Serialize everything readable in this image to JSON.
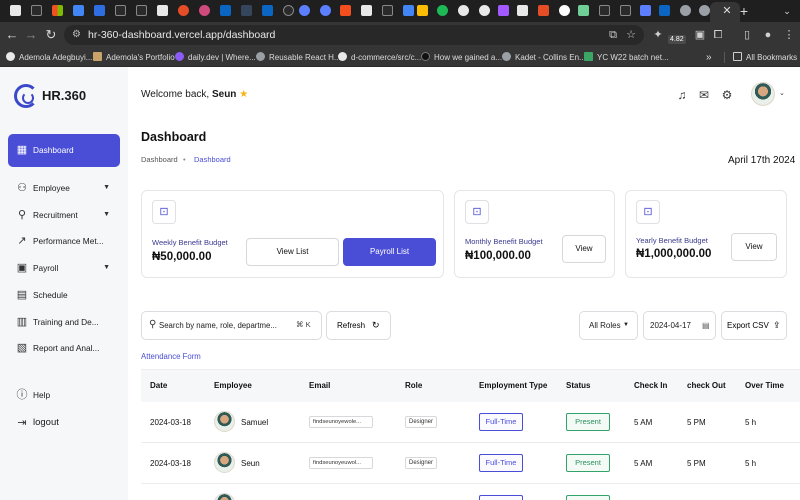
{
  "browser": {
    "url": "hr-360-dashboard.vercel.app/dashboard",
    "extension_badge": "4.82",
    "bookmarks": [
      {
        "label": "Ademola Adegbuyi...",
        "color": "#e8e8e8"
      },
      {
        "label": "Ademola's Portfolio",
        "color": "#c9a36a"
      },
      {
        "label": "daily.dev | Where...",
        "color": "#8b5cf6"
      },
      {
        "label": "Reusable React H...",
        "color": "#9aa0a6"
      },
      {
        "label": "d-commerce/src/c...",
        "color": "#e8e8e8"
      },
      {
        "label": "How we gained a...",
        "color": "#111111"
      },
      {
        "label": "Kadet - Collins En...",
        "color": "#9aa0a6"
      },
      {
        "label": "YC W22 batch net...",
        "color": "#3aa564"
      }
    ],
    "all_bookmarks": "All Bookmarks"
  },
  "sidebar": {
    "brand": "HR.360",
    "items": [
      {
        "label": "Dashboard",
        "icon": "grid-icon",
        "active": true
      },
      {
        "label": "Employee",
        "icon": "people-icon",
        "has_submenu": true
      },
      {
        "label": "Recruitment",
        "icon": "person-add-icon",
        "has_submenu": true
      },
      {
        "label": "Performance Met...",
        "icon": "chart-icon"
      },
      {
        "label": "Payroll",
        "icon": "wallet-icon",
        "has_submenu": true
      },
      {
        "label": "Schedule",
        "icon": "calendar-icon"
      },
      {
        "label": "Training and De...",
        "icon": "book-icon"
      },
      {
        "label": "Report and Anal...",
        "icon": "report-icon"
      }
    ],
    "help": "Help",
    "logout": "logout"
  },
  "header": {
    "welcome_prefix": "Welcome back,",
    "user_name": "Seun",
    "icons": [
      "bell-icon",
      "mail-icon",
      "settings-icon"
    ]
  },
  "page": {
    "title": "Dashboard",
    "breadcrumb": [
      "Dashboard",
      "Dashboard"
    ],
    "date": "April 17th 2024"
  },
  "cards": [
    {
      "label": "Weekly Benefit Budget",
      "value": "₦50,000.00",
      "buttons": [
        "View List",
        "Payroll List"
      ]
    },
    {
      "label": "Monthly Benefit Budget",
      "value": "₦100,000.00",
      "buttons": [
        "View"
      ]
    },
    {
      "label": "Yearly Benefit Budget",
      "value": "₦1,000,000.00",
      "buttons": [
        "View"
      ]
    }
  ],
  "filters": {
    "search_placeholder": "Search by name, role, departme...",
    "search_shortcut": "⌘ K",
    "refresh": "Refresh",
    "roles": "All Roles",
    "date": "2024-04-17",
    "export": "Export CSV"
  },
  "attendance": {
    "link": "Attendance Form",
    "columns": [
      "Date",
      "Employee",
      "Email",
      "Role",
      "Employment Type",
      "Status",
      "Check In",
      "check Out",
      "Over Time"
    ],
    "rows": [
      {
        "date": "2024-03-18",
        "employee": "Samuel",
        "email": "findseunoyewole...",
        "role": "Designer",
        "type": "Full-Time",
        "status": "Present",
        "check_in": "5 AM",
        "check_out": "5 PM",
        "overtime": "5 h"
      },
      {
        "date": "2024-03-18",
        "employee": "Seun",
        "email": "findseunoyeuwol...",
        "role": "Designer",
        "type": "Full-Time",
        "status": "Present",
        "check_in": "5 AM",
        "check_out": "5 PM",
        "overtime": "5 h"
      }
    ]
  },
  "colors": {
    "accent": "#4a4ed6",
    "present": "#2b8f5c",
    "star": "#f2b511"
  }
}
